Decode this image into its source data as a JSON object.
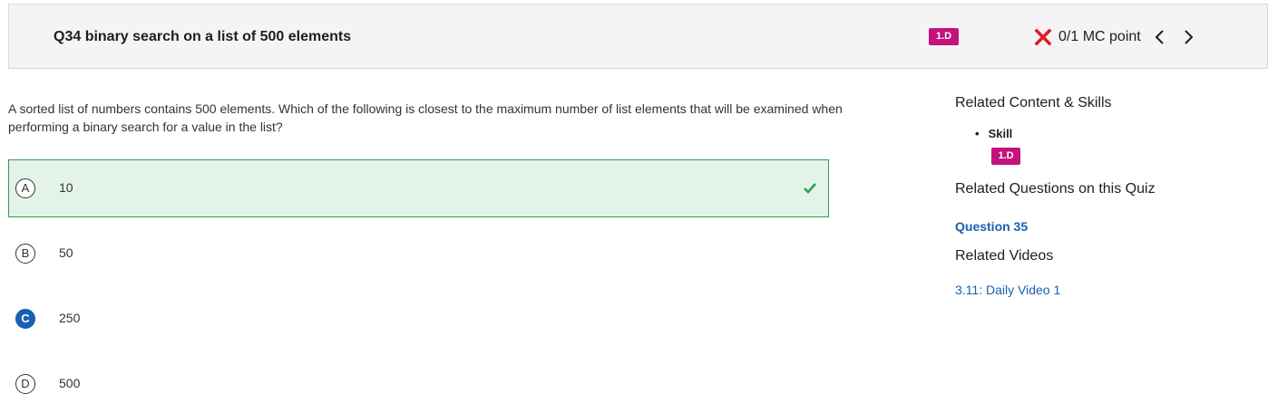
{
  "header": {
    "title": "Q34 binary search on a list of 500 elements",
    "skill_badge": "1.D",
    "score": "0/1 MC point",
    "status_icon": "x-icon",
    "colors": {
      "badge": "#c4127f",
      "incorrect": "#e01b24"
    }
  },
  "question": {
    "text": "A sorted list of numbers contains 500 elements. Which of the following is closest to the maximum number of list elements that will be examined when performing a binary search for a value in the list?",
    "choices": [
      {
        "letter": "A",
        "value": "10",
        "correct": true,
        "selected": false
      },
      {
        "letter": "B",
        "value": "50",
        "correct": false,
        "selected": false
      },
      {
        "letter": "C",
        "value": "250",
        "correct": false,
        "selected": true
      },
      {
        "letter": "D",
        "value": "500",
        "correct": false,
        "selected": false
      }
    ],
    "colors": {
      "correct_bg": "#e3f3e9",
      "correct_border": "#2e9e4a",
      "selected": "#1a5fb4"
    }
  },
  "sidebar": {
    "content_heading": "Related Content & Skills",
    "skill_label": "Skill",
    "skill_badge": "1.D",
    "questions_heading": "Related Questions on this Quiz",
    "question_link": "Question 35",
    "videos_heading": "Related Videos",
    "video_link": "3.11: Daily Video 1",
    "link_color": "#1a5fb4"
  }
}
